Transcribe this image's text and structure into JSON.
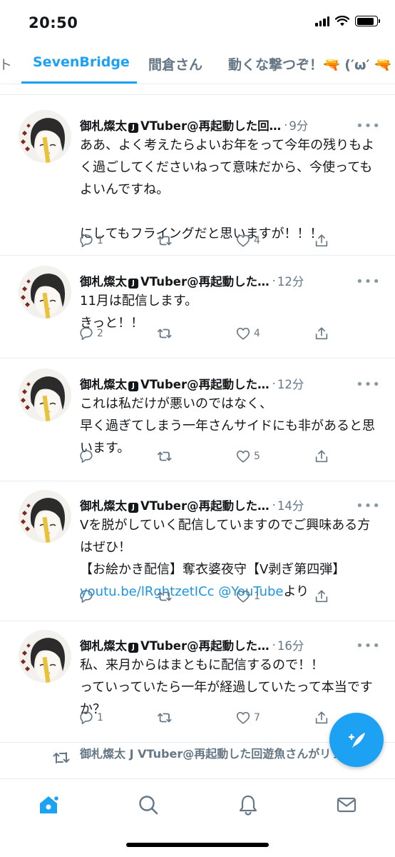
{
  "status_bar": {
    "time": "20:50",
    "signal_icon": "cellular-signal-icon",
    "wifi_icon": "wifi-icon",
    "battery_icon": "battery-icon"
  },
  "tabs": [
    {
      "label": "SevenBridge",
      "active": true
    },
    {
      "label": "間倉さん",
      "active": false
    },
    {
      "label": "動くな撃つぞ！🔫 (′ω′ 🔫",
      "active": false
    }
  ],
  "tab_overflow_glyph": "ト",
  "colors": {
    "accent": "#1da1f2",
    "secondary_text": "#657786",
    "link": "#1b95e0",
    "divider": "#e6ecf0"
  },
  "tweets": [
    {
      "name": "御札燦太",
      "badge": "J",
      "handle_suffix": "VTuber@再起動した回…",
      "dot": "·",
      "time": "9分",
      "text": "ああ、よく考えたらよいお年をって今年の残りもよく過ごしてくださいねって意味だから、今使ってもよいんですね。\n\nにしてもフライングだと思いますが！！！",
      "replies": "1",
      "retweets": "",
      "likes": "4"
    },
    {
      "name": "御札燦太",
      "badge": "J",
      "handle_suffix": "VTuber@再起動した…",
      "dot": "·",
      "time": "12分",
      "text": "11月は配信します。\nきっと！！",
      "replies": "2",
      "retweets": "",
      "likes": "4"
    },
    {
      "name": "御札燦太",
      "badge": "J",
      "handle_suffix": "VTuber@再起動した…",
      "dot": "·",
      "time": "12分",
      "text": "これは私だけが悪いのではなく、\n早く過ぎてしまう一年さんサイドにも非があると思います。",
      "replies": "",
      "retweets": "",
      "likes": "5"
    },
    {
      "name": "御札燦太",
      "badge": "J",
      "handle_suffix": "VTuber@再起動した…",
      "dot": "·",
      "time": "14分",
      "text": "Vを脱がしていく配信していますのでご興味ある方はぜひ！\n【お絵かき配信】奪衣婆夜守【V剥ぎ第四弾】",
      "link_text": "youtu.be/lRghtzetICc @YouTube",
      "link_suffix": "より",
      "replies": "",
      "retweets": "",
      "likes": "1"
    },
    {
      "name": "御札燦太",
      "badge": "J",
      "handle_suffix": "VTuber@再起動した…",
      "dot": "·",
      "time": "16分",
      "text": "私、来月からはまともに配信するので！！\nっていっていたら一年が経過していたって本当ですか？",
      "replies": "1",
      "retweets": "",
      "likes": "7"
    }
  ],
  "retweet_preview": {
    "label": "御札燦太 J VTuber@再起動した回遊魚さんがリツイート"
  },
  "more_glyph": "•••",
  "nav": [
    {
      "name": "home",
      "icon": "home-icon",
      "active": true
    },
    {
      "name": "search",
      "icon": "search-icon",
      "active": false
    },
    {
      "name": "notifications",
      "icon": "bell-icon",
      "active": false
    },
    {
      "name": "messages",
      "icon": "mail-icon",
      "active": false
    }
  ],
  "compose_icon": "compose-tweet-icon"
}
